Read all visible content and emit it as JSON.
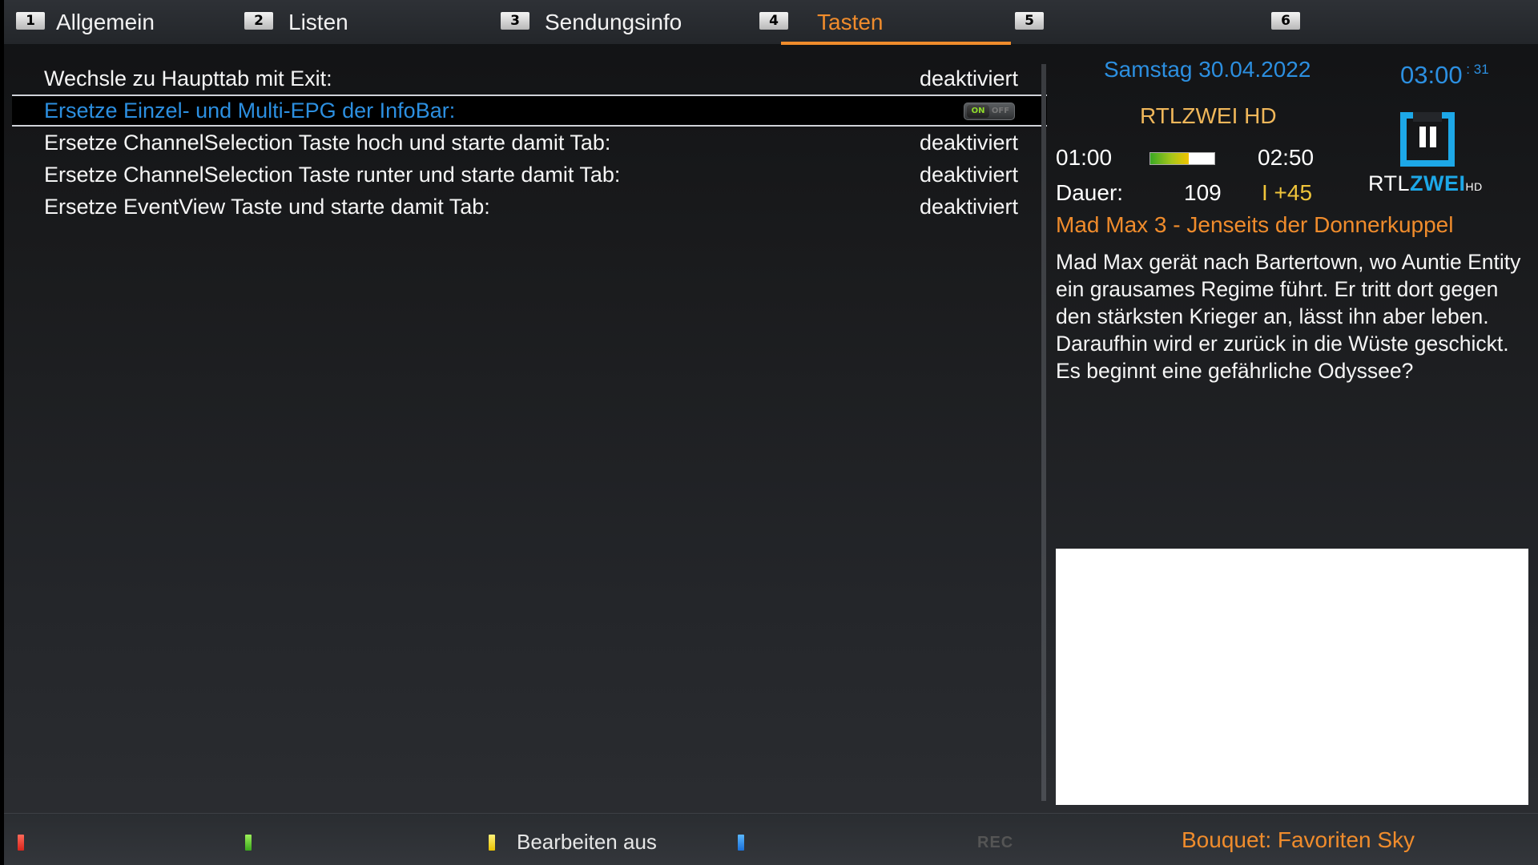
{
  "tabs": [
    {
      "number": "1",
      "label": "Allgemein"
    },
    {
      "number": "2",
      "label": "Listen"
    },
    {
      "number": "3",
      "label": "Sendungsinfo"
    },
    {
      "number": "4",
      "label": "Tasten"
    },
    {
      "number": "5",
      "label": ""
    },
    {
      "number": "6",
      "label": ""
    }
  ],
  "active_tab": "Tasten",
  "settings": [
    {
      "label": "Wechsle zu Haupttab mit Exit:",
      "value": "deaktiviert"
    },
    {
      "label": "Ersetze Einzel- und Multi-EPG der InfoBar:",
      "toggle_on": "ON",
      "toggle_off": "OFF"
    },
    {
      "label": "Ersetze ChannelSelection Taste hoch und starte damit Tab:",
      "value": "deaktiviert"
    },
    {
      "label": "Ersetze ChannelSelection Taste runter und starte damit Tab:",
      "value": "deaktiviert"
    },
    {
      "label": "Ersetze EventView Taste und starte damit Tab:",
      "value": "deaktiviert"
    }
  ],
  "info": {
    "date": "Samstag 30.04.2022",
    "time": "03:00",
    "seconds": "31",
    "channel": "RTLZWEI HD",
    "start": "01:00",
    "end": "02:50",
    "progress_percent": 60,
    "duration_label": "Dauer:",
    "duration": "109",
    "offset": "I +45",
    "logo": {
      "part1": "RTL",
      "part2": "ZWEI",
      "suffix": "HD"
    },
    "event_title": "Mad Max 3 - Jenseits der Donnerkuppel",
    "description": "Mad Max gerät nach Bartertown, wo Auntie Entity ein grausames Regime führt. Er tritt dort gegen den stärksten Krieger an, lässt ihn aber leben. Daraufhin wird er zurück in die Wüste geschickt. Es beginnt eine gefährliche Odyssee?"
  },
  "bottom": {
    "yellow_label": "Bearbeiten aus",
    "rec": "REC",
    "bouquet": "Bouquet: Favoriten Sky"
  },
  "colors": {
    "accent_orange": "#f08c2c",
    "accent_blue": "#2c8fe0",
    "channel_gold": "#f0b75a",
    "logo_blue": "#1da8e8"
  }
}
